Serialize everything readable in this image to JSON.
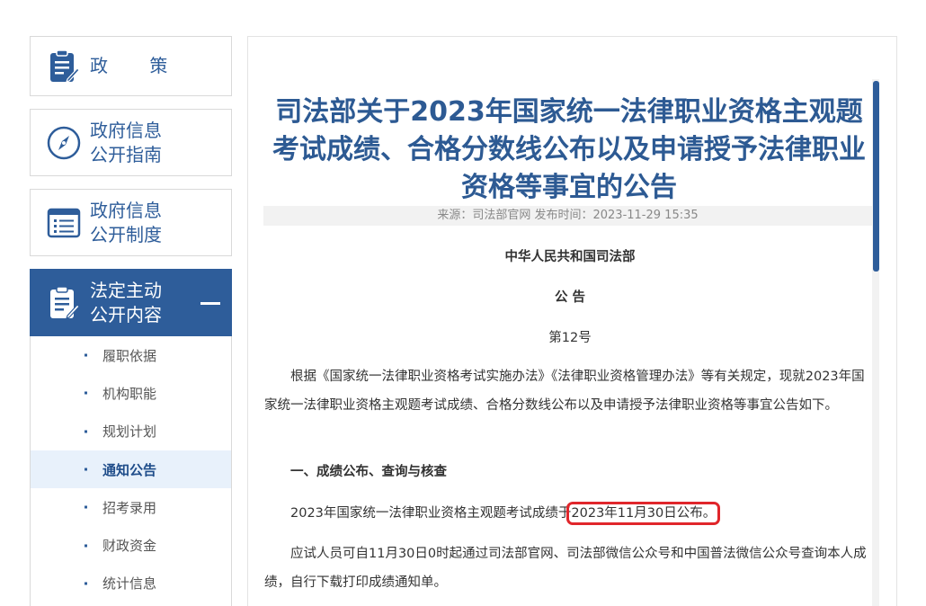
{
  "sidebar": {
    "policy_label": "政 策",
    "guide_label_1": "政府信息",
    "guide_label_2": "公开指南",
    "system_label_1": "政府信息",
    "system_label_2": "公开制度",
    "active_label_1": "法定主动",
    "active_label_2": "公开内容",
    "sub_items": [
      {
        "label": "履职依据"
      },
      {
        "label": "机构职能"
      },
      {
        "label": "规划计划"
      },
      {
        "label": "通知公告"
      },
      {
        "label": "招考录用"
      },
      {
        "label": "财政资金"
      },
      {
        "label": "统计信息"
      }
    ]
  },
  "article": {
    "title": "司法部关于2023年国家统一法律职业资格主观题考试成绩、合格分数线公布以及申请授予法律职业资格等事宜的公告",
    "source": "来源：司法部官网 发布时间：2023-11-29 15:35",
    "issuer": "中华人民共和国司法部",
    "doc_type": "公 告",
    "doc_no": "第12号",
    "intro": "根据《国家统一法律职业资格考试实施办法》《法律职业资格管理办法》等有关规定，现就2023年国家统一法律职业资格主观题考试成绩、合格分数线公布以及申请授予法律职业资格等事宜公告如下。",
    "section1_heading": "一、成绩公布、查询与核查",
    "p1_prefix": "2023年国家统一法律职业资格主观题考试成绩于",
    "p1_highlight": "2023年11月30日公布。",
    "p2": "应试人员可自11月30日0时起通过司法部官网、司法部微信公众号和中国普法微信公众号查询本人成绩，自行下载打印成绩通知单。"
  },
  "colors": {
    "brand_blue": "#2e5d9a",
    "title_blue": "#2d5a93",
    "highlight_red": "#e0262b",
    "active_sub_bg": "#e8f1fb"
  },
  "icons": {
    "policy": "clipboard-pen-icon",
    "guide": "compass-icon",
    "system": "list-document-icon",
    "active": "clipboard-pen-icon"
  }
}
